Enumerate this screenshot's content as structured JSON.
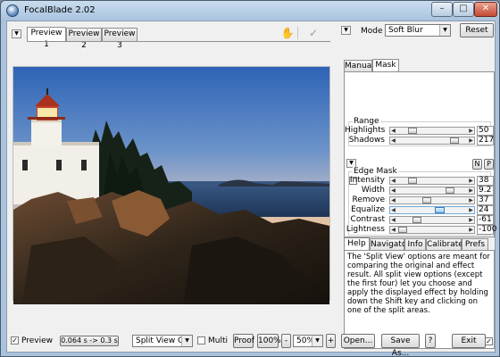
{
  "window": {
    "title": "FocalBlade 2.02"
  },
  "preview_tabs": [
    "Preview 1",
    "Preview 2",
    "Preview 3"
  ],
  "mode": {
    "label": "Mode",
    "value": "Soft Blur",
    "reset_label": "Reset"
  },
  "settings_tabs": [
    "Manual",
    "Mask"
  ],
  "range": {
    "title": "Range",
    "sliders": [
      {
        "label": "Highlights",
        "value": "50",
        "fraction": 0.18
      },
      {
        "label": "Shadows",
        "value": "217",
        "fraction": 0.85
      }
    ]
  },
  "edge_mask": {
    "title": "Edge Mask",
    "n_label": "N",
    "p_label": "P",
    "sliders": [
      {
        "label": "Intensity",
        "value": "38",
        "fraction": 0.18
      },
      {
        "label": "Width",
        "value": "9.2",
        "fraction": 0.78
      },
      {
        "label": "Remove",
        "value": "37",
        "fraction": 0.42
      },
      {
        "label": "Equalize",
        "value": "24",
        "fraction": 0.62
      },
      {
        "label": "Contrast",
        "value": "-61",
        "fraction": 0.25
      },
      {
        "label": "Lightness",
        "value": "-100",
        "fraction": 0.03
      }
    ]
  },
  "info_tabs": [
    "Help",
    "Navigator",
    "Info",
    "Calibrate",
    "Prefs"
  ],
  "help_text": "The 'Split View' options are meant for comparing the original and effect result. All split view options (except the first four) let you choose and apply the displayed effect by holding down the Shift key and clicking on one of the split areas.",
  "status": {
    "preview_label": "Preview",
    "timing": "0.064 s -> 0.3 s",
    "split_view": "Split View Off",
    "multi_label": "Multi",
    "proof_label": "Proof",
    "zoom_100_label": "100%",
    "zoom_minus": "-",
    "zoom_value": "50%",
    "zoom_plus": "+",
    "open_label": "Open...",
    "save_label": "Save As...",
    "help_label": "?",
    "exit_label": "Exit"
  },
  "colors": {
    "titlebar": "#a9c3de",
    "close": "#c44a32",
    "accent_slider": "#6fa8dc"
  }
}
